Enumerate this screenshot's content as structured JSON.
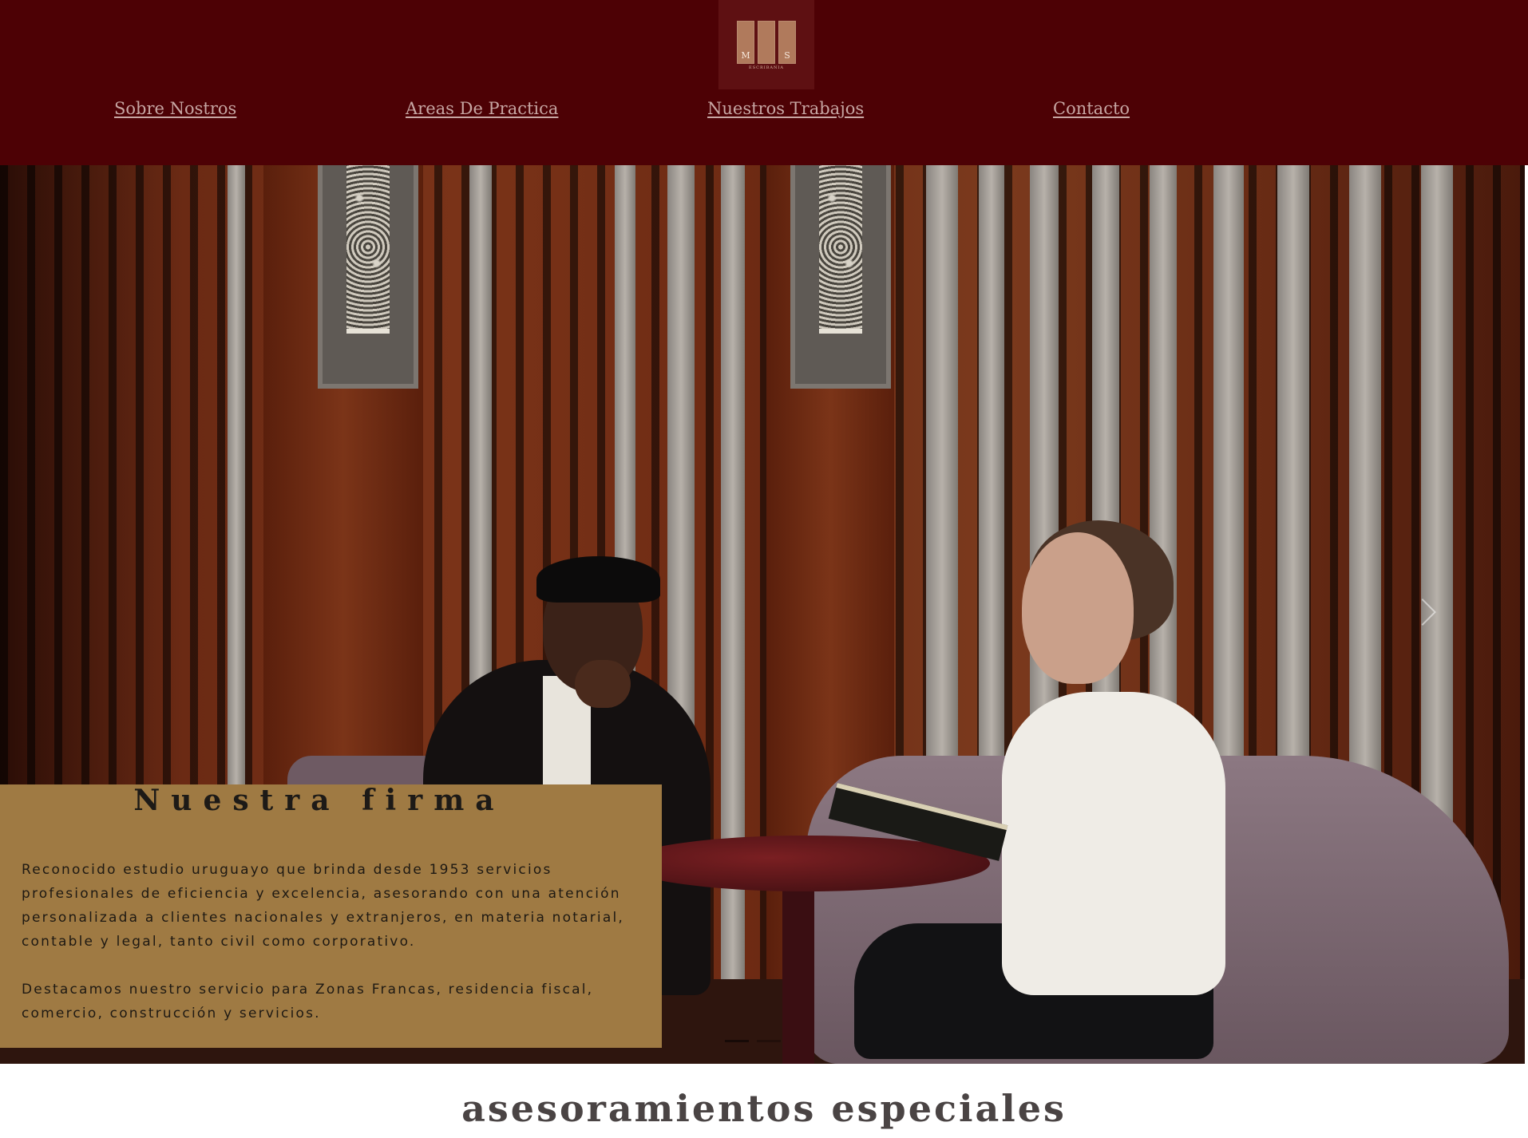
{
  "header": {
    "logo": {
      "letters": [
        "M",
        "",
        "S"
      ],
      "tagline": "ESCRIBANIA"
    },
    "nav": [
      {
        "label": "Sobre Nostros"
      },
      {
        "label": "Areas De Practica"
      },
      {
        "label": "Nuestros Trabajos"
      },
      {
        "label": "Contacto"
      }
    ]
  },
  "hero": {
    "carousel": {
      "next_icon": "chevron-right-icon",
      "slides": 2,
      "active_slide": 1
    }
  },
  "card": {
    "title": "Nuestra firma",
    "paragraph_1": "Reconocido estudio uruguayo que brinda desde 1953 servicios profesionales de eficiencia y excelencia, asesorando con una atención personalizada a clientes nacionales y extranjeros, en materia notarial, contable y legal, tanto civil como corporativo.",
    "paragraph_2": "Destacamos nuestro servicio para Zonas Francas, residencia fiscal, comercio, construcción y servicios."
  },
  "section": {
    "title": "asesoramientos especiales"
  },
  "colors": {
    "header_bg": "#4d0105",
    "nav_link": "#c7a6a3",
    "card_bg": "#9f7a43",
    "title_text": "#4a4444"
  }
}
